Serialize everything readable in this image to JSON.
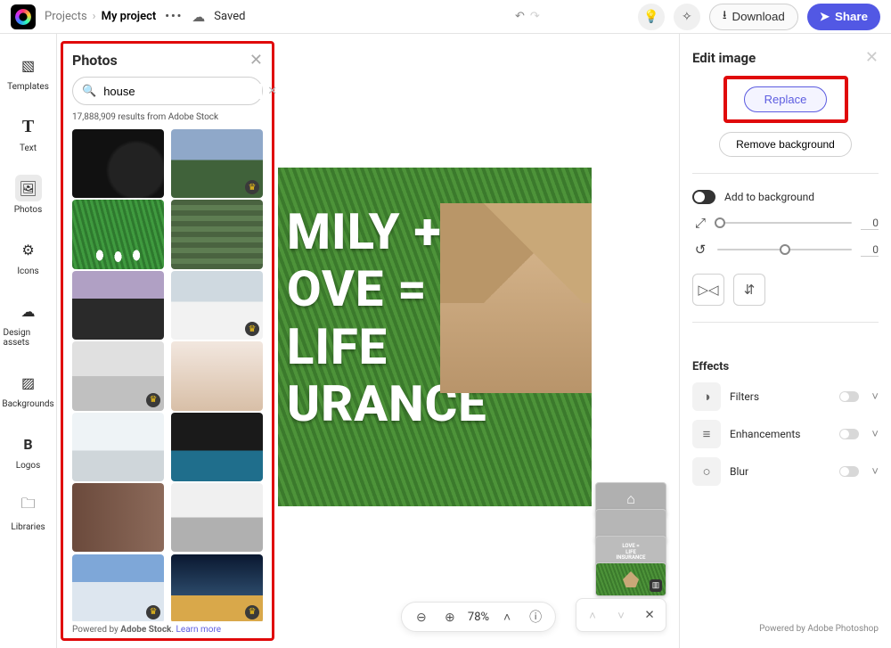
{
  "header": {
    "projects_label": "Projects",
    "project_name": "My project",
    "saved_label": "Saved",
    "download_label": "Download",
    "share_label": "Share"
  },
  "rail": {
    "items": [
      {
        "label": "Templates"
      },
      {
        "label": "Text"
      },
      {
        "label": "Photos"
      },
      {
        "label": "Icons"
      },
      {
        "label": "Design assets"
      },
      {
        "label": "Backgrounds"
      },
      {
        "label": "Logos"
      },
      {
        "label": "Libraries"
      }
    ]
  },
  "photos": {
    "title": "Photos",
    "search_value": "house",
    "results_count": "17,888,909 results from Adobe Stock",
    "powered_prefix": "Powered by ",
    "powered_brand": "Adobe Stock",
    "learn_more": "Learn more"
  },
  "canvas": {
    "text": "MILY +\nOVE =\nLIFE\nURANCE",
    "zoom": "78%",
    "mini3_text": "LOVE =\nLIFE\nINSURANCE"
  },
  "edit": {
    "title": "Edit image",
    "replace": "Replace",
    "remove_bg": "Remove background",
    "add_to_bg": "Add to background",
    "resize_val": "0",
    "rotate_val": "0",
    "effects_title": "Effects",
    "effects": [
      {
        "label": "Filters"
      },
      {
        "label": "Enhancements"
      },
      {
        "label": "Blur"
      }
    ],
    "footer": "Powered by Adobe Photoshop"
  }
}
